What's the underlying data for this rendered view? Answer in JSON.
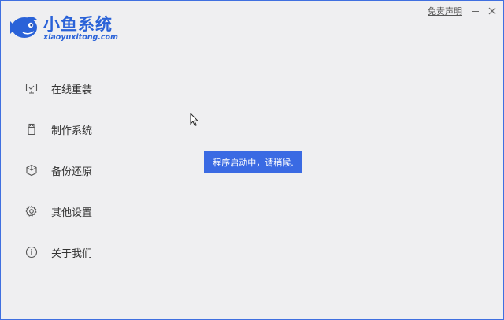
{
  "app": {
    "logo_title": "小鱼系统",
    "logo_subtitle": "xiaoyuxitong.com",
    "brand_color": "#2a62d8"
  },
  "topbar": {
    "disclaimer_label": "免责声明",
    "minimize_icon": "minimize-icon",
    "close_icon": "close-icon"
  },
  "sidebar": {
    "items": [
      {
        "label": "在线重装",
        "icon": "monitor-icon"
      },
      {
        "label": "制作系统",
        "icon": "usb-drive-icon"
      },
      {
        "label": "备份还原",
        "icon": "backup-restore-icon"
      },
      {
        "label": "其他设置",
        "icon": "gear-icon"
      },
      {
        "label": "关于我们",
        "icon": "info-icon"
      }
    ]
  },
  "toast": {
    "message": "程序启动中，请稍候.",
    "color": "#3a6ae3"
  }
}
